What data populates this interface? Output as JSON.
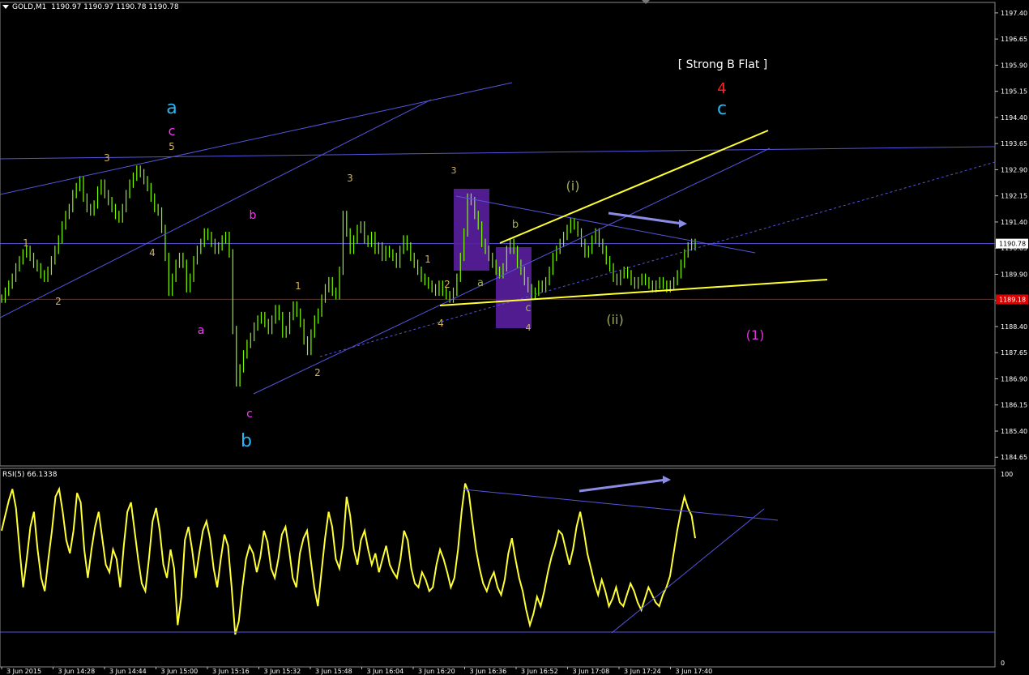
{
  "header": {
    "symbol": "GOLD,M1",
    "ohlc": "1190.97 1190.97 1190.78 1190.78"
  },
  "rsi_label": "RSI(5) 66.1338",
  "colors": {
    "background": "#000000",
    "candles": "#7CFC00",
    "rsi_line": "#FFFF33",
    "trendline": "#5555dd",
    "yellow_line": "#FFFF33",
    "support_line": "#dd0000",
    "box": "#5a1f9e",
    "axis_text": "#ffffff"
  },
  "chart_data": [
    {
      "type": "line",
      "title": "GOLD,M1",
      "ylim": [
        1184.4,
        1197.7
      ],
      "y_ticks": [
        "1197.40",
        "1196.65",
        "1195.90",
        "1195.15",
        "1194.40",
        "1193.65",
        "1192.90",
        "1192.15",
        "1191.40",
        "1190.65",
        "1189.90",
        "1189.15",
        "1188.40",
        "1187.65",
        "1186.90",
        "1186.15",
        "1185.40",
        "1184.65"
      ],
      "x_ticks": [
        "3 Jun 2015",
        "3 Jun 14:28",
        "3 Jun 14:44",
        "3 Jun 15:00",
        "3 Jun 15:16",
        "3 Jun 15:32",
        "3 Jun 15:48",
        "3 Jun 16:04",
        "3 Jun 16:20",
        "3 Jun 16:36",
        "3 Jun 16:52",
        "3 Jun 17:08",
        "3 Jun 17:24",
        "3 Jun 17:40"
      ],
      "current_price": "1190.78",
      "support_price": "1189.18",
      "series": [
        {
          "name": "GOLD,M1",
          "values": [
            1189.2,
            1189.4,
            1189.6,
            1189.8,
            1190.1,
            1190.3,
            1190.5,
            1190.6,
            1190.4,
            1190.2,
            1190.1,
            1189.9,
            1189.8,
            1190.0,
            1190.3,
            1190.6,
            1190.9,
            1191.3,
            1191.6,
            1191.8,
            1192.2,
            1192.4,
            1192.6,
            1192.1,
            1191.8,
            1191.7,
            1191.9,
            1192.3,
            1192.5,
            1192.2,
            1192.0,
            1191.8,
            1191.6,
            1191.5,
            1191.8,
            1192.2,
            1192.5,
            1192.7,
            1192.9,
            1192.8,
            1192.6,
            1192.4,
            1192.1,
            1191.8,
            1191.7,
            1191.2,
            1190.4,
            1189.4,
            1189.8,
            1190.2,
            1190.4,
            1190.2,
            1189.5,
            1189.8,
            1190.3,
            1190.6,
            1190.8,
            1191.1,
            1191.0,
            1190.8,
            1190.6,
            1190.7,
            1190.9,
            1191.0,
            1190.5,
            1188.3,
            1186.8,
            1187.2,
            1187.6,
            1187.9,
            1188.1,
            1188.4,
            1188.6,
            1188.7,
            1188.5,
            1188.3,
            1188.6,
            1188.9,
            1188.7,
            1188.2,
            1188.3,
            1188.7,
            1189.0,
            1188.8,
            1188.5,
            1188.0,
            1187.7,
            1188.2,
            1188.6,
            1188.8,
            1189.2,
            1189.5,
            1189.7,
            1189.4,
            1189.3,
            1190.0,
            1191.6,
            1191.1,
            1190.6,
            1190.9,
            1191.2,
            1191.3,
            1190.9,
            1190.8,
            1191.0,
            1190.6,
            1190.7,
            1190.4,
            1190.6,
            1190.5,
            1190.4,
            1190.2,
            1190.6,
            1190.9,
            1190.7,
            1190.4,
            1190.2,
            1190.0,
            1189.8,
            1189.7,
            1189.6,
            1189.5,
            1189.4,
            1189.6,
            1189.4,
            1189.3,
            1189.2,
            1189.4,
            1189.8,
            1190.4,
            1191.1,
            1192.1,
            1192.0,
            1191.6,
            1191.3,
            1190.8,
            1190.6,
            1190.4,
            1190.2,
            1190.0,
            1189.9,
            1190.1,
            1190.6,
            1190.8,
            1190.6,
            1190.2,
            1190.0,
            1189.7,
            1189.5,
            1189.3,
            1189.4,
            1189.6,
            1189.5,
            1189.7,
            1190.0,
            1190.4,
            1190.6,
            1190.8,
            1191.0,
            1191.2,
            1191.4,
            1191.3,
            1191.1,
            1190.8,
            1190.5,
            1190.6,
            1190.9,
            1191.1,
            1190.8,
            1190.6,
            1190.3,
            1190.1,
            1189.8,
            1189.7,
            1189.9,
            1190.0,
            1189.9,
            1189.7,
            1189.6,
            1189.7,
            1189.8,
            1189.7,
            1189.6,
            1189.5,
            1189.6,
            1189.7,
            1189.6,
            1189.5,
            1189.6,
            1189.7,
            1189.9,
            1190.2,
            1190.5,
            1190.7,
            1190.8,
            1190.7
          ]
        }
      ]
    },
    {
      "type": "line",
      "title": "RSI(5) 66.1338",
      "ylim": [
        0,
        100
      ],
      "y_ticks": [
        "100",
        "0"
      ],
      "series": [
        {
          "name": "RSI(5) 66.1338",
          "values": [
            70,
            78,
            86,
            92,
            82,
            60,
            40,
            55,
            72,
            80,
            60,
            45,
            38,
            55,
            70,
            88,
            92,
            80,
            65,
            58,
            70,
            90,
            85,
            60,
            45,
            60,
            72,
            80,
            66,
            52,
            48,
            60,
            55,
            40,
            62,
            80,
            85,
            70,
            55,
            42,
            38,
            55,
            75,
            82,
            70,
            52,
            45,
            60,
            50,
            20,
            35,
            65,
            72,
            60,
            45,
            58,
            70,
            75,
            66,
            50,
            40,
            55,
            68,
            62,
            40,
            15,
            22,
            40,
            55,
            62,
            58,
            48,
            56,
            70,
            64,
            50,
            45,
            55,
            68,
            72,
            60,
            45,
            40,
            58,
            66,
            70,
            55,
            40,
            30,
            48,
            66,
            80,
            72,
            55,
            50,
            62,
            88,
            78,
            60,
            52,
            65,
            70,
            60,
            52,
            58,
            48,
            55,
            62,
            52,
            48,
            45,
            55,
            70,
            65,
            50,
            42,
            40,
            48,
            44,
            38,
            40,
            52,
            60,
            55,
            48,
            40,
            45,
            60,
            80,
            95,
            90,
            75,
            60,
            50,
            42,
            38,
            44,
            48,
            40,
            36,
            44,
            58,
            66,
            55,
            45,
            38,
            28,
            20,
            26,
            35,
            30,
            38,
            48,
            56,
            62,
            70,
            68,
            60,
            52,
            60,
            72,
            80,
            70,
            58,
            50,
            42,
            36,
            44,
            38,
            30,
            34,
            40,
            32,
            30,
            36,
            42,
            38,
            32,
            28,
            34,
            40,
            36,
            32,
            30,
            36,
            40,
            46,
            58,
            70,
            80,
            88,
            82,
            78,
            66
          ]
        }
      ]
    }
  ],
  "annotations": {
    "strong_b_flat": "[ Strong B Flat ]",
    "wave_4": "4",
    "wave_c_blue": "c",
    "wave_a_blue": "a",
    "wave_c_magenta_top": "c",
    "wave_5_top": "5",
    "wave_3_left": "3",
    "wave_1_left": "1",
    "wave_2_left": "2",
    "wave_4_left": "4",
    "wave_a_magenta": "a",
    "wave_b_magenta": "b",
    "wave_c_magenta_bottom": "c",
    "wave_b_blue": "b",
    "wave_1_mid": "1",
    "wave_2_mid": "2",
    "wave_3_mid": "3",
    "wave_4_mid": "4",
    "wave_1_right": "1",
    "wave_2_right": "2",
    "wave_3_right": "3",
    "wave_4_right": "4",
    "wave_a_small": "a",
    "wave_b_small": "b",
    "wave_c_small": "c",
    "wave_i": "(i)",
    "wave_ii": "(ii)",
    "wave_1_paren": "(1)"
  }
}
